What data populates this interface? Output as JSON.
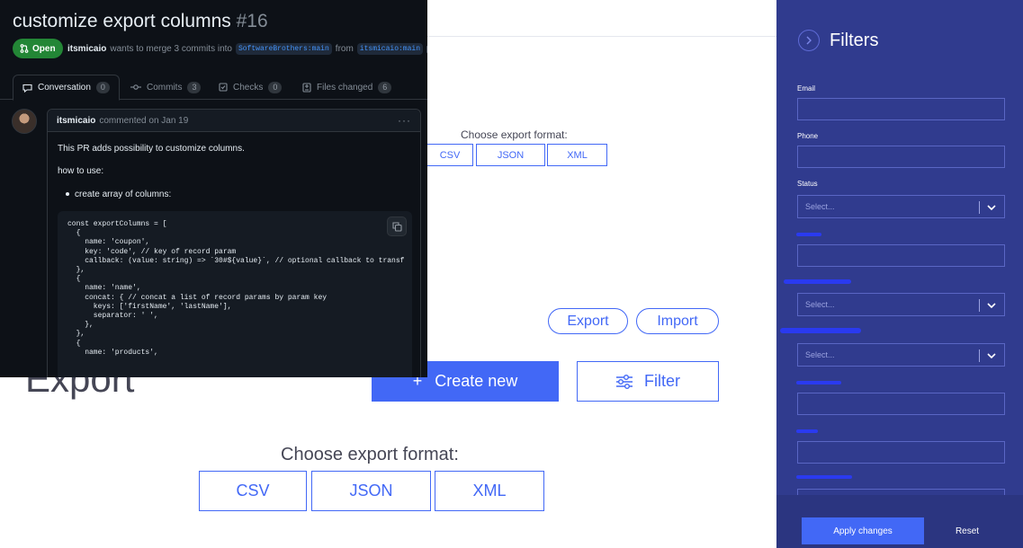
{
  "colors": {
    "accent": "#4268f6",
    "drawer_bg": "#303b8e",
    "github_bg": "#0d1117",
    "open_badge": "#238636"
  },
  "pull_request": {
    "title": "customize export columns",
    "number": "#16",
    "status": "Open",
    "author": "itsmicaio",
    "meta_text": "wants to merge 3 commits into",
    "base_branch": "SoftwareBrothers:main",
    "from_text": "from",
    "head_branch": "itsmicaio:main",
    "tabs": [
      {
        "label": "Conversation",
        "count": "0",
        "icon": "comment-icon"
      },
      {
        "label": "Commits",
        "count": "3",
        "icon": "commit-icon"
      },
      {
        "label": "Checks",
        "count": "0",
        "icon": "checks-icon"
      },
      {
        "label": "Files changed",
        "count": "6",
        "icon": "file-diff-icon"
      }
    ],
    "comment": {
      "author": "itsmicaio",
      "meta": "commented on Jan 19",
      "menu": "···",
      "line1": "This PR adds possibility to customize columns.",
      "line2": "how to use:",
      "bullet1": "create array of columns:",
      "code": "const exportColumns = [\n  {\n    name: 'coupon',\n    key: 'code', // key of record param\n    callback: (value: string) => `30#${value}`, // optional callback to transf\n  },\n  {\n    name: 'name',\n    concat: { // concat a list of record params by param key\n      keys: ['firstName', 'lastName'],\n      separator: ' ',\n    },\n  },\n  {\n    name: 'products',"
    }
  },
  "app": {
    "small_choose": "Choose export format:",
    "small_formats": [
      "CSV",
      "JSON",
      "XML"
    ],
    "export_pill": "Export",
    "import_pill": "Import",
    "page_title": "Export",
    "create_plus": "+",
    "create_label": "Create new",
    "filter_label": "Filter",
    "big_choose": "Choose export format:",
    "big_formats": [
      "CSV",
      "JSON",
      "XML"
    ]
  },
  "filters": {
    "title": "Filters",
    "email_label": "Email",
    "phone_label": "Phone",
    "status_label": "Status",
    "status_placeholder": "Select...",
    "select2_placeholder": "Select...",
    "select3_placeholder": "Select...",
    "apply_label": "Apply changes",
    "reset_label": "Reset"
  }
}
